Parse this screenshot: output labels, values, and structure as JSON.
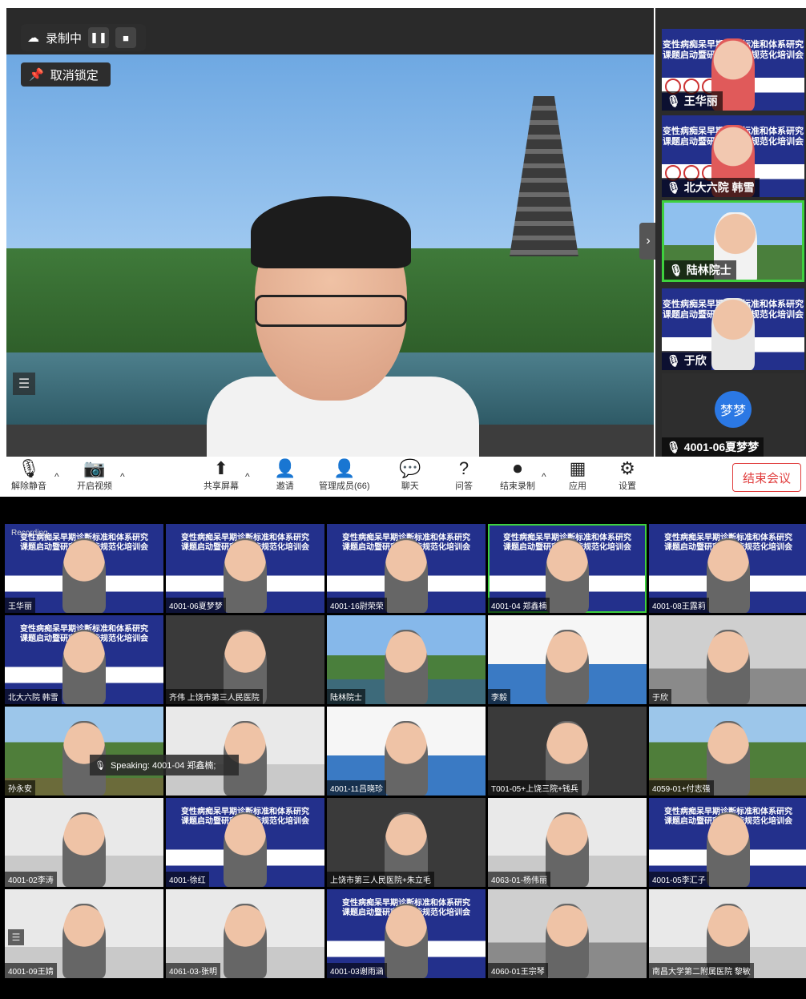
{
  "recording": {
    "label": "录制中",
    "pause_icon": "❚❚",
    "stop_icon": "■"
  },
  "unlock": {
    "label": "取消锁定"
  },
  "thumbs": [
    {
      "name": "王华丽",
      "type": "slide",
      "active": false
    },
    {
      "name": "北大六院 韩雪",
      "type": "slide",
      "active": false
    },
    {
      "name": "陆林院士",
      "type": "lake",
      "active": true
    },
    {
      "name": "于欣",
      "type": "slide",
      "active": false
    }
  ],
  "mengmeng": {
    "avatar": "梦梦",
    "name": "4001-06夏梦梦"
  },
  "slide_title": "变性病痴呆早期诊断标准和体系研究\n课题启动暨研究者技能规范化培训会",
  "toolbar": {
    "mute": "解除静音",
    "video": "开启视频",
    "share": "共享屏幕",
    "invite": "邀请",
    "members": "管理成员(66)",
    "chat": "聊天",
    "qa": "问答",
    "end_record": "结束录制",
    "apps": "应用",
    "settings": "设置",
    "end_meeting": "结束会议"
  },
  "grid": [
    [
      "王华丽",
      "4001-06夏梦梦",
      "4001-16尉荣荣",
      "4001-04 郑鑫楠",
      "4001-08王露莉"
    ],
    [
      "北大六院 韩雪",
      "齐伟 上饶市第三人民医院",
      "陆林院士",
      "李毅",
      "于欣"
    ],
    [
      "孙永安",
      "",
      "4001-11吕晓珍",
      "T001-05+上饶三院+钱兵",
      "4059-01+付志强"
    ],
    [
      "4001-02李涛",
      "4001-徐红",
      "上饶市第三人民医院+朱立毛",
      "4063-01-杨伟丽",
      "4001-05李汇子"
    ],
    [
      "4001-09王婧",
      "4061-03-张明",
      "4001-03谢雨涵",
      "4060-01王宗琴",
      "南昌大学第二附属医院 黎敏"
    ]
  ],
  "grid_bg": [
    [
      "slide",
      "slide",
      "slide",
      "slide",
      "slide"
    ],
    [
      "slide",
      "dark",
      "lake",
      "blue",
      "office"
    ],
    [
      "mount",
      "room",
      "blue",
      "dark",
      "mount"
    ],
    [
      "room",
      "slide",
      "dark",
      "room",
      "slide"
    ],
    [
      "room",
      "room",
      "slide",
      "office",
      "room"
    ]
  ],
  "speaking": "Speaking: 4001-04 郑鑫楠;",
  "rec_mini": "Recording"
}
